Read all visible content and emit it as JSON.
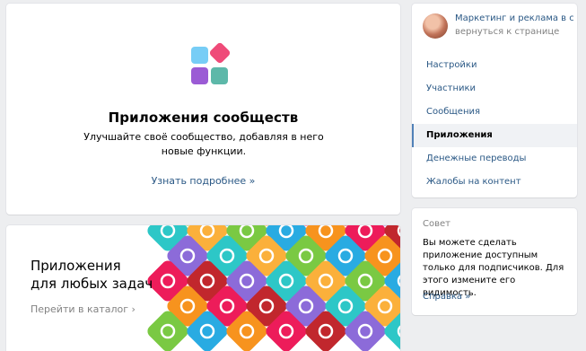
{
  "intro": {
    "title": "Приложения сообществ",
    "description": "Улучшайте своё сообщество, добавляя в него новые функции.",
    "link": "Узнать подробнее »"
  },
  "catalog": {
    "title_line1": "Приложения",
    "title_line2": "для любых задач",
    "link": "Перейти в каталог ›",
    "tile_icons": [
      "flower-icon",
      "airplane-icon",
      "bell-icon",
      "chat-icon",
      "sun-icon",
      "cloud-icon",
      "location-icon",
      "rocket-icon",
      "flask-icon",
      "flag-icon"
    ],
    "tile_colors": [
      "#7ac943",
      "#29abe2",
      "#f7931e",
      "#ed1c5a",
      "#c1272d",
      "#8c6bd9",
      "#2dc7c7",
      "#fbb03b"
    ]
  },
  "sidebar": {
    "group_name": "Маркетинг и реклама в с...",
    "group_back": "вернуться к странице",
    "items": [
      {
        "label": "Настройки"
      },
      {
        "label": "Участники"
      },
      {
        "label": "Сообщения"
      },
      {
        "label": "Приложения"
      },
      {
        "label": "Денежные переводы"
      },
      {
        "label": "Жалобы на контент"
      }
    ],
    "active_index": 3
  },
  "tip": {
    "title": "Совет",
    "text": "Вы можете сделать приложение доступным только для подписчиков. Для этого измените его видимость.",
    "link": "Справка »"
  },
  "colors": {
    "link": "#2a5885",
    "accent": "#5181b8",
    "background": "#edeef0"
  }
}
